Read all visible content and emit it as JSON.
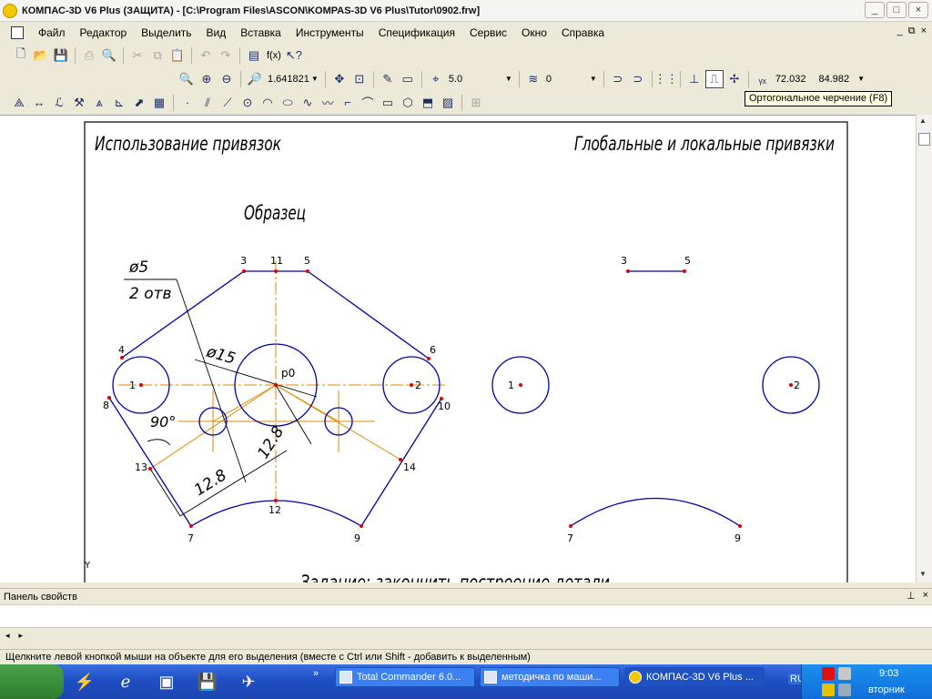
{
  "window": {
    "title": "КОМПАС-3D V6 Plus (ЗАЩИТА) - [C:\\Program Files\\ASCON\\KOMPAS-3D V6 Plus\\Tutor\\0902.frw]",
    "buttons": [
      "_",
      "□",
      "×"
    ]
  },
  "menu": {
    "items": [
      "Файл",
      "Редактор",
      "Выделить",
      "Вид",
      "Вставка",
      "Инструменты",
      "Спецификация",
      "Сервис",
      "Окно",
      "Справка"
    ],
    "right": [
      "_",
      "⧉",
      "×"
    ]
  },
  "toolbar1": {
    "fx_label": "f(x)"
  },
  "toolbar2": {
    "zoom_value": "1.641821",
    "step_value": "5.0",
    "layer_value": "0",
    "coord_x": "72.032",
    "coord_y": "84.982"
  },
  "tooltip": "Ортогональное черчение (F8)",
  "drawing": {
    "title_left": "Использование привязок",
    "title_right": "Глобальные и локальные привязки",
    "sample_label": "Образец",
    "dim_diam5": "ø5",
    "dim_holes": "2 отв",
    "dim_diam15": "ø15",
    "dim_angle": "90°",
    "dim_128a": "12.8",
    "dim_128b": "12.8",
    "center_label": "p0",
    "task_text": "Задание: закончить построение детали",
    "point_labels": [
      "3",
      "11",
      "5",
      "4",
      "6",
      "1",
      "2",
      "8",
      "10",
      "13",
      "14",
      "12",
      "7",
      "9"
    ],
    "right_labels": [
      "3",
      "5",
      "1",
      "2",
      "7",
      "9"
    ],
    "axis_y": "Y"
  },
  "colors": {
    "outline": "#0000a8",
    "construction": "#e08a00",
    "dimension": "#000000",
    "point": "#e00000"
  },
  "panel": {
    "title": "Панель свойств",
    "controls": [
      "⊥",
      "×"
    ]
  },
  "hscroll": {
    "left": "◂",
    "right": "▸"
  },
  "status": "Щелкните левой кнопкой мыши на объекте для его выделения (вместе с Ctrl или Shift - добавить к выделенным)",
  "taskbar": {
    "tasks": [
      "Total Commander 6.0...",
      "методичка по маши...",
      "КОМПАС-3D V6 Plus ..."
    ],
    "lang": "RU",
    "time": "9:03",
    "day": "вторник",
    "more": "»"
  }
}
